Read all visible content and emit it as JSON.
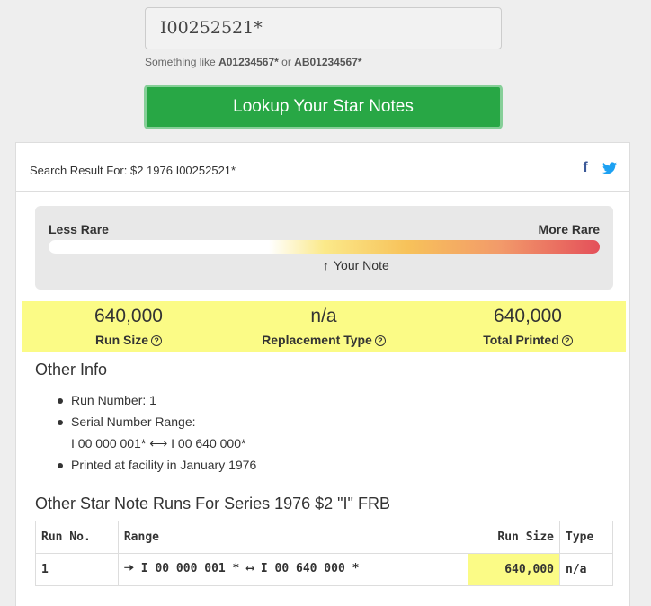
{
  "search": {
    "value": "I00252521*",
    "hint_prefix": "Something like",
    "hint_example1": "A01234567*",
    "hint_or": "or",
    "hint_example2": "AB01234567*"
  },
  "lookup_button": "Lookup Your Star Notes",
  "result": {
    "header": "Search Result For: $2 1976 I00252521*",
    "facebook_icon": "f"
  },
  "rarity": {
    "less_label": "Less Rare",
    "more_label": "More Rare",
    "pointer_label": "Your Note",
    "level": 0.48
  },
  "stats": {
    "run_size_value": "640,000",
    "run_size_label": "Run Size",
    "replacement_value": "n/a",
    "replacement_label": "Replacement Type",
    "total_value": "640,000",
    "total_label": "Total Printed",
    "help_glyph": "?"
  },
  "other_info": {
    "title": "Other Info",
    "run_number": "Run Number: 1",
    "serial_range_label": "Serial Number Range:",
    "serial_start": "I 00 000 001*",
    "serial_end": "I 00 640 000*",
    "printed": "Printed at facility in January 1976"
  },
  "runs": {
    "title": "Other Star Note Runs For Series 1976 $2 \"I\" FRB",
    "headers": {
      "run_no": "Run No.",
      "range": "Range",
      "run_size": "Run Size",
      "type": "Type"
    },
    "rows": [
      {
        "run_no": "1",
        "range_start": "I 00 000 001 *",
        "range_end": "I 00 640 000 *",
        "run_size": "640,000",
        "type": "n/a"
      }
    ]
  },
  "colors": {
    "button_green": "#28a745",
    "highlight_yellow": "#fbfb86",
    "facebook_blue": "#3b5998",
    "twitter_blue": "#1da1f2"
  }
}
